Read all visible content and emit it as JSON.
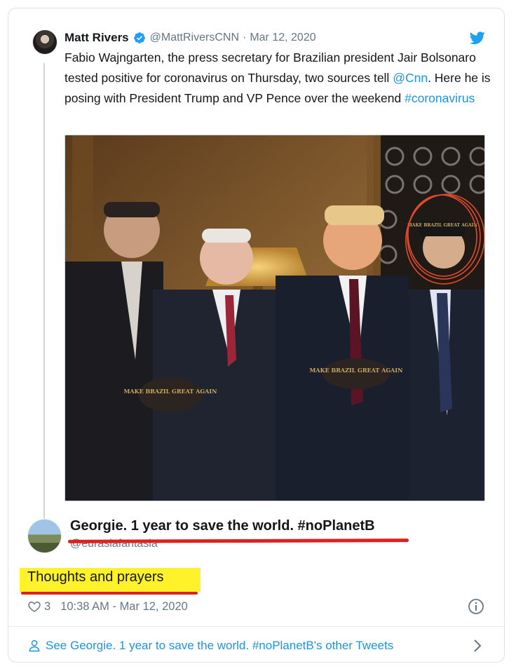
{
  "quoted_tweet": {
    "author_name": "Matt Rivers",
    "handle": "@MattRiversCNN",
    "separator": "·",
    "date": "Mar 12, 2020",
    "text_part1": "Fabio Wajngarten, the press secretary for Brazilian president Jair Bolsonaro tested positive for coronavirus on Thursday, two sources tell ",
    "mention": "@Cnn",
    "text_part2": ". Here he is posing with President Trump and VP Pence over the weekend ",
    "hashtag": "#coronavirus",
    "photo_caps": [
      "MAKE BRAZIL GREAT AGAIN",
      "MAKE BRAZIL GREAT AGAIN",
      "MAKE BRAZIL GREAT AGAIN"
    ]
  },
  "reply": {
    "author_name": "Georgie. 1 year to save the world. #noPlanetB",
    "handle": "@eurasiafantasia",
    "text": "Thoughts and prayers",
    "like_count": "3",
    "timestamp": "10:38 AM - Mar 12, 2020"
  },
  "footer": {
    "label": "See Georgie. 1 year to save the world. #noPlanetB's other Tweets"
  },
  "colors": {
    "link": "#1b95e0",
    "annotation_red": "#e0201f",
    "highlight_yellow": "#fff22b",
    "muted": "#657786"
  },
  "icons": {
    "verified": "verified-badge-icon",
    "twitter": "twitter-bird-icon",
    "like": "heart-icon",
    "info": "info-icon",
    "profile": "person-icon",
    "more": "chevron-right-icon"
  }
}
